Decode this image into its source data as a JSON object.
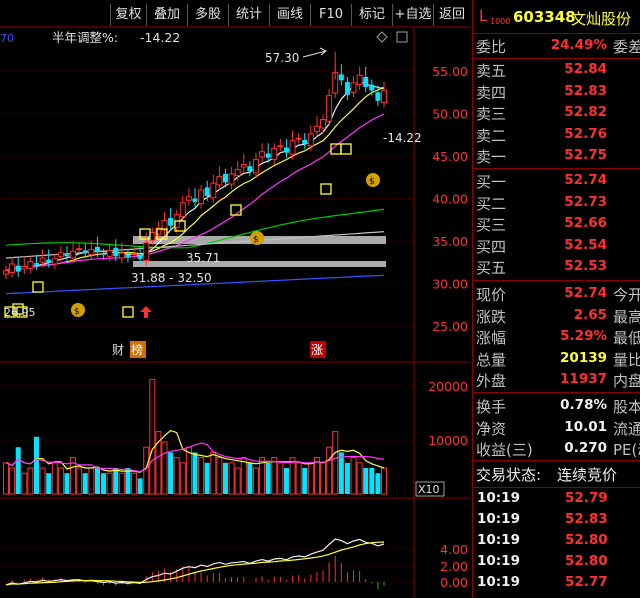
{
  "toolbar": {
    "buttons": [
      "复权",
      "叠加",
      "多股",
      "统计",
      "画线",
      "F10",
      "标记",
      "+自选",
      "返回"
    ]
  },
  "chart": {
    "indicator_label": "半年调整%:",
    "indicator_value": "-14.22",
    "y_ticks": [
      "55.00",
      "50.00",
      "45.00",
      "40.00",
      "35.00",
      "30.00",
      "25.00"
    ],
    "high_marker": "57.30",
    "current_pct": "-14.22",
    "band_labels": [
      "35.71",
      "31.88 - 32.50"
    ],
    "small_label": "26.95",
    "partial_label": "70",
    "event_tags": [
      "财",
      "榜",
      "涨"
    ],
    "volume_ticks": [
      "20000",
      "10000"
    ],
    "volume_unit": "X10",
    "macd_ticks": [
      "4.00",
      "2.00",
      "0.00"
    ],
    "colors": {
      "up": "#ff3030",
      "down": "#00e5ff",
      "ma5": "#f0f0f0",
      "ma10": "#ffff33",
      "ma20": "#ff33ff",
      "ma30": "#00cc00",
      "ma60": "#c0c0c0",
      "ma120": "#3355ff"
    }
  },
  "quote": {
    "level_prefix": "L",
    "level_sub": "1000",
    "code": "603348",
    "name": "文灿股份",
    "weibi": {
      "label": "委比",
      "value": "24.49%",
      "extra": "委差"
    },
    "asks": [
      {
        "label": "卖五",
        "price": "52.84"
      },
      {
        "label": "卖四",
        "price": "52.83"
      },
      {
        "label": "卖三",
        "price": "52.82"
      },
      {
        "label": "卖二",
        "price": "52.76"
      },
      {
        "label": "卖一",
        "price": "52.75"
      }
    ],
    "bids": [
      {
        "label": "买一",
        "price": "52.74"
      },
      {
        "label": "买二",
        "price": "52.73"
      },
      {
        "label": "买三",
        "price": "52.66"
      },
      {
        "label": "买四",
        "price": "52.54"
      },
      {
        "label": "买五",
        "price": "52.53"
      }
    ],
    "stats": [
      {
        "label": "现价",
        "value": "52.74",
        "extra": "今开",
        "color": "red"
      },
      {
        "label": "涨跌",
        "value": "2.65",
        "extra": "最高",
        "color": "red"
      },
      {
        "label": "涨幅",
        "value": "5.29%",
        "extra": "最低",
        "color": "red"
      },
      {
        "label": "总量",
        "value": "20139",
        "extra": "量比",
        "color": "yellow"
      },
      {
        "label": "外盘",
        "value": "11937",
        "extra": "内盘",
        "color": "red"
      }
    ],
    "fundamentals": [
      {
        "label": "换手",
        "value": "0.78%",
        "extra": "股本"
      },
      {
        "label": "净资",
        "value": "10.01",
        "extra": "流通"
      },
      {
        "label": "收益(三)",
        "value": "0.270",
        "extra": "PE(动)"
      }
    ],
    "trade_status_label": "交易状态:",
    "trade_status_value": "连续竞价",
    "ticks": [
      {
        "time": "10:19",
        "price": "52.79"
      },
      {
        "time": "10:19",
        "price": "52.83"
      },
      {
        "time": "10:19",
        "price": "52.80"
      },
      {
        "time": "10:19",
        "price": "52.80"
      },
      {
        "time": "10:19",
        "price": "52.77"
      }
    ]
  }
}
